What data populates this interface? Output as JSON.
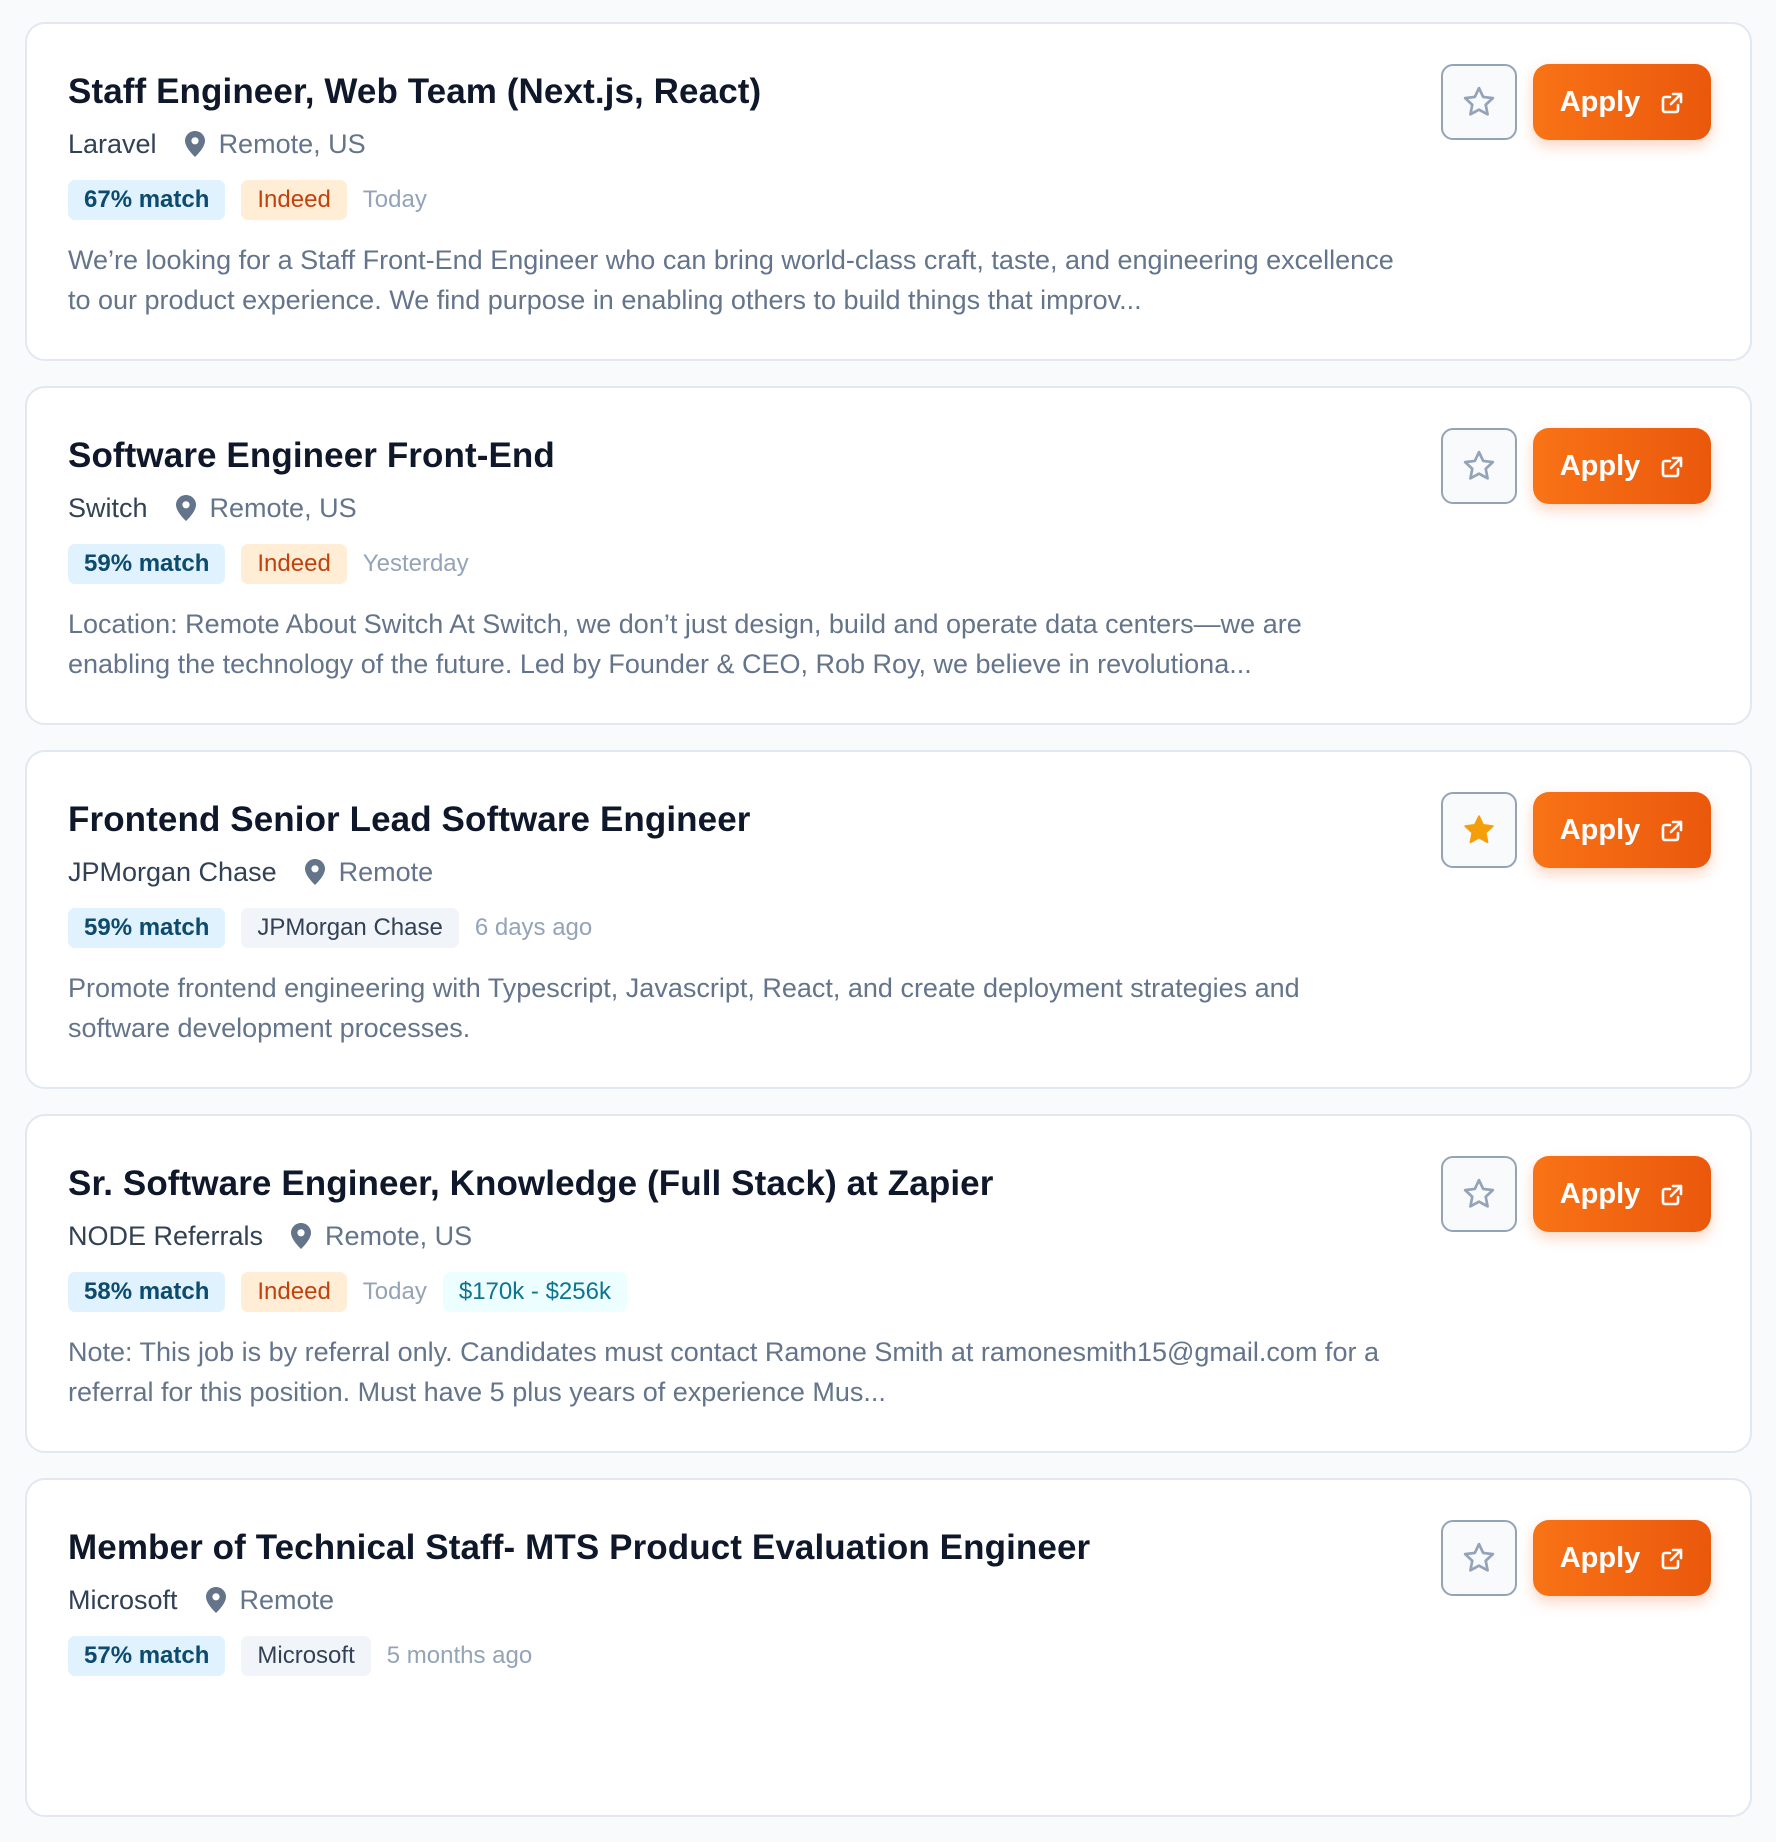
{
  "colors": {
    "accent": "#ea580c",
    "accent_light": "#f97316",
    "star_filled": "#f59e0b",
    "star_outline": "#94a3b8",
    "match_badge_bg": "#e0f2fe",
    "match_badge_text": "#0c4a6e",
    "indeed_badge_bg": "#ffedd5",
    "indeed_badge_text": "#c2410c"
  },
  "icons": {
    "location": "map-pin-icon",
    "save": "star-icon",
    "apply": "external-link-icon"
  },
  "jobs": [
    {
      "title": "Staff Engineer, Web Team (Next.js, React)",
      "company": "Laravel",
      "location": "Remote, US",
      "match": "67% match",
      "source": "Indeed",
      "posted": "Today",
      "salary": "",
      "description": "We’re looking for a Staff Front-End Engineer who can bring world-class craft, taste, and engineering excellence to our product experience. We find purpose in enabling others to build things that improv...",
      "saved": false,
      "apply_label": "Apply"
    },
    {
      "title": "Software Engineer Front-End",
      "company": "Switch",
      "location": "Remote, US",
      "match": "59% match",
      "source": "Indeed",
      "posted": "Yesterday",
      "salary": "",
      "description": "Location: Remote About Switch At Switch, we don’t just design, build and operate data centers—we are enabling the technology of the future. Led by Founder & CEO, Rob Roy, we believe in revolutiona...",
      "saved": false,
      "apply_label": "Apply"
    },
    {
      "title": "Frontend Senior Lead Software Engineer",
      "company": "JPMorgan Chase",
      "location": "Remote",
      "match": "59% match",
      "source": "JPMorgan Chase",
      "posted": "6 days ago",
      "salary": "",
      "description": "Promote frontend engineering with Typescript, Javascript, React, and create deployment strategies and software development processes.",
      "saved": true,
      "apply_label": "Apply"
    },
    {
      "title": "Sr. Software Engineer, Knowledge (Full Stack) at Zapier",
      "company": "NODE Referrals",
      "location": "Remote, US",
      "match": "58% match",
      "source": "Indeed",
      "posted": "Today",
      "salary": "$170k - $256k",
      "description": "Note: This job is by referral only. Candidates must contact Ramone Smith at ramonesmith15@gmail.com for a referral for this position. Must have 5 plus years of experience Mus...",
      "saved": false,
      "apply_label": "Apply"
    },
    {
      "title": "Member of Technical Staff- MTS Product Evaluation Engineer",
      "company": "Microsoft",
      "location": "Remote",
      "match": "57% match",
      "source": "Microsoft",
      "posted": "5 months ago",
      "salary": "",
      "description": "",
      "saved": false,
      "apply_label": "Apply"
    }
  ]
}
